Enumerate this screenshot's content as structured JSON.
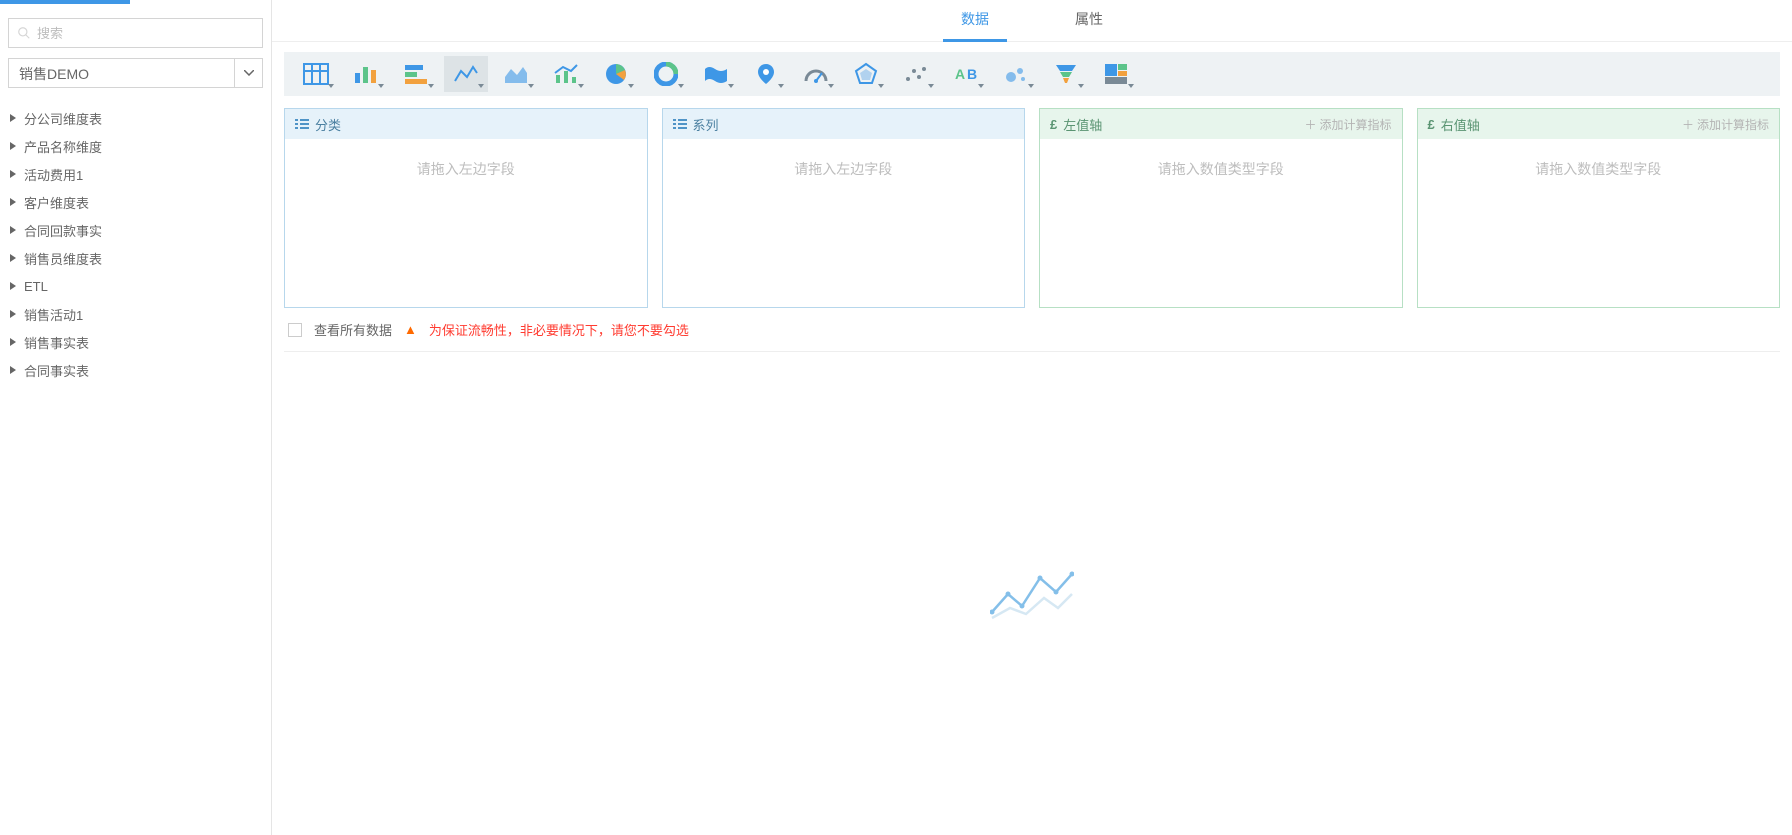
{
  "sidebar": {
    "search_placeholder": "搜索",
    "select_label": "销售DEMO",
    "items": [
      {
        "label": "分公司维度表"
      },
      {
        "label": "产品名称维度"
      },
      {
        "label": "活动费用1"
      },
      {
        "label": "客户维度表"
      },
      {
        "label": "合同回款事实"
      },
      {
        "label": "销售员维度表"
      },
      {
        "label": "ETL"
      },
      {
        "label": "销售活动1"
      },
      {
        "label": "销售事实表"
      },
      {
        "label": "合同事实表"
      }
    ]
  },
  "tabs": {
    "data": "数据",
    "attributes": "属性"
  },
  "toolbar_icons": [
    {
      "name": "table-icon"
    },
    {
      "name": "column-chart-icon"
    },
    {
      "name": "bar-chart-icon"
    },
    {
      "name": "line-chart-icon",
      "selected": true
    },
    {
      "name": "area-chart-icon"
    },
    {
      "name": "combo-chart-icon"
    },
    {
      "name": "pie-chart-icon"
    },
    {
      "name": "donut-chart-icon"
    },
    {
      "name": "map-icon"
    },
    {
      "name": "geo-pin-icon"
    },
    {
      "name": "gauge-icon"
    },
    {
      "name": "radar-icon"
    },
    {
      "name": "scatter-icon"
    },
    {
      "name": "text-icon"
    },
    {
      "name": "bubble-icon"
    },
    {
      "name": "funnel-icon"
    },
    {
      "name": "treemap-icon"
    }
  ],
  "dropzones": {
    "category": {
      "title": "分类",
      "hint": "请拖入左边字段"
    },
    "series": {
      "title": "系列",
      "hint": "请拖入左边字段"
    },
    "left": {
      "title": "左值轴",
      "add": "添加计算指标",
      "hint": "请拖入数值类型字段"
    },
    "right": {
      "title": "右值轴",
      "add": "添加计算指标",
      "hint": "请拖入数值类型字段"
    }
  },
  "view_all": {
    "label": "查看所有数据",
    "warning": "为保证流畅性，非必要情况下，请您不要勾选"
  }
}
